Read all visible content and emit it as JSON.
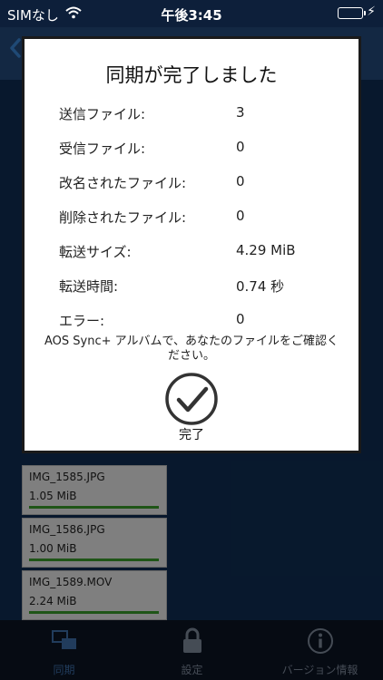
{
  "status_bar": {
    "carrier": "SIMなし",
    "time": "午後3:45"
  },
  "files": [
    {
      "name": "IMG_1585.JPG",
      "size": "1.05 MiB",
      "progress": 1.0
    },
    {
      "name": "IMG_1586.JPG",
      "size": "1.00 MiB",
      "progress": 1.0
    },
    {
      "name": "IMG_1589.MOV",
      "size": "2.24 MiB",
      "progress": 1.0
    }
  ],
  "tabs": [
    {
      "label": "同期",
      "icon": "sync-devices-icon",
      "active": true
    },
    {
      "label": "設定",
      "icon": "lock-icon",
      "active": false
    },
    {
      "label": "バージョン情報",
      "icon": "info-icon",
      "active": false
    }
  ],
  "dialog": {
    "title": "同期が完了しました",
    "stats": [
      {
        "label": "送信ファイル:",
        "value": "3"
      },
      {
        "label": "受信ファイル:",
        "value": "0"
      },
      {
        "label": "改名されたファイル:",
        "value": "0"
      },
      {
        "label": "削除されたファイル:",
        "value": "0"
      },
      {
        "label": "転送サイズ:",
        "value": "4.29 MiB"
      },
      {
        "label": "転送時間:",
        "value": "0.74 秒"
      },
      {
        "label": "エラー:",
        "value": "0"
      }
    ],
    "message": "AOS Sync+ アルバムで、あなたのファイルをご確認ください。",
    "done_label": "完了"
  },
  "colors": {
    "progress": "#3a9b2a",
    "tab_active": "#3c6ea8"
  }
}
